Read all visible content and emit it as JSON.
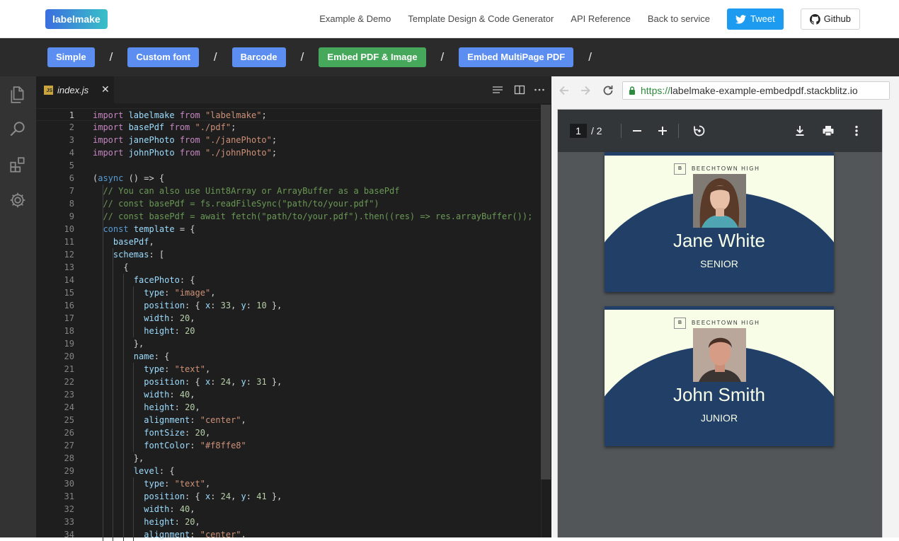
{
  "brand": "labelmake",
  "nav": {
    "links": [
      "Example & Demo",
      "Template Design & Code Generator",
      "API Reference",
      "Back to service"
    ],
    "tweet": "Tweet",
    "github": "Github"
  },
  "examples": {
    "items": [
      "Simple",
      "Custom font",
      "Barcode",
      "Embed PDF & Image",
      "Embed MultiPage PDF"
    ],
    "separator": "/",
    "active_index": 3
  },
  "editor": {
    "tab": "index.js",
    "tab_badge": "JS",
    "current_line": 1,
    "lines": [
      [
        [
          "k",
          "import "
        ],
        [
          "v",
          "labelmake "
        ],
        [
          "k",
          "from "
        ],
        [
          "s",
          "\"labelmake\""
        ],
        [
          "p",
          ";"
        ]
      ],
      [
        [
          "k",
          "import "
        ],
        [
          "v",
          "basePdf "
        ],
        [
          "k",
          "from "
        ],
        [
          "s",
          "\"./pdf\""
        ],
        [
          "p",
          ";"
        ]
      ],
      [
        [
          "k",
          "import "
        ],
        [
          "v",
          "janePhoto "
        ],
        [
          "k",
          "from "
        ],
        [
          "s",
          "\"./janePhoto\""
        ],
        [
          "p",
          ";"
        ]
      ],
      [
        [
          "k",
          "import "
        ],
        [
          "v",
          "johnPhoto "
        ],
        [
          "k",
          "from "
        ],
        [
          "s",
          "\"./johnPhoto\""
        ],
        [
          "p",
          ";"
        ]
      ],
      [],
      [
        [
          "p",
          "("
        ],
        [
          "kb",
          "async"
        ],
        [
          "p",
          " () => {"
        ]
      ],
      [
        [
          "p",
          "  "
        ],
        [
          "c",
          "// You can also use Uint8Array or ArrayBuffer as a basePdf"
        ]
      ],
      [
        [
          "p",
          "  "
        ],
        [
          "c",
          "// const basePdf = fs.readFileSync(\"path/to/your.pdf\")"
        ]
      ],
      [
        [
          "p",
          "  "
        ],
        [
          "c",
          "// const basePdf = await fetch(\"path/to/your.pdf\").then((res) => res.arrayBuffer());"
        ]
      ],
      [
        [
          "p",
          "  "
        ],
        [
          "kb",
          "const "
        ],
        [
          "v",
          "template"
        ],
        [
          "p",
          " = {"
        ]
      ],
      [
        [
          "p",
          "    "
        ],
        [
          "v",
          "basePdf"
        ],
        [
          "p",
          ","
        ]
      ],
      [
        [
          "p",
          "    "
        ],
        [
          "v",
          "schemas"
        ],
        [
          "p",
          ": ["
        ]
      ],
      [
        [
          "p",
          "      {"
        ]
      ],
      [
        [
          "p",
          "        "
        ],
        [
          "v",
          "facePhoto"
        ],
        [
          "p",
          ": {"
        ]
      ],
      [
        [
          "p",
          "          "
        ],
        [
          "v",
          "type"
        ],
        [
          "p",
          ": "
        ],
        [
          "s",
          "\"image\""
        ],
        [
          "p",
          ","
        ]
      ],
      [
        [
          "p",
          "          "
        ],
        [
          "v",
          "position"
        ],
        [
          "p",
          ": { "
        ],
        [
          "v",
          "x"
        ],
        [
          "p",
          ": "
        ],
        [
          "n",
          "33"
        ],
        [
          "p",
          ", "
        ],
        [
          "v",
          "y"
        ],
        [
          "p",
          ": "
        ],
        [
          "n",
          "10"
        ],
        [
          "p",
          " },"
        ]
      ],
      [
        [
          "p",
          "          "
        ],
        [
          "v",
          "width"
        ],
        [
          "p",
          ": "
        ],
        [
          "n",
          "20"
        ],
        [
          "p",
          ","
        ]
      ],
      [
        [
          "p",
          "          "
        ],
        [
          "v",
          "height"
        ],
        [
          "p",
          ": "
        ],
        [
          "n",
          "20"
        ]
      ],
      [
        [
          "p",
          "        },"
        ]
      ],
      [
        [
          "p",
          "        "
        ],
        [
          "v",
          "name"
        ],
        [
          "p",
          ": {"
        ]
      ],
      [
        [
          "p",
          "          "
        ],
        [
          "v",
          "type"
        ],
        [
          "p",
          ": "
        ],
        [
          "s",
          "\"text\""
        ],
        [
          "p",
          ","
        ]
      ],
      [
        [
          "p",
          "          "
        ],
        [
          "v",
          "position"
        ],
        [
          "p",
          ": { "
        ],
        [
          "v",
          "x"
        ],
        [
          "p",
          ": "
        ],
        [
          "n",
          "24"
        ],
        [
          "p",
          ", "
        ],
        [
          "v",
          "y"
        ],
        [
          "p",
          ": "
        ],
        [
          "n",
          "31"
        ],
        [
          "p",
          " },"
        ]
      ],
      [
        [
          "p",
          "          "
        ],
        [
          "v",
          "width"
        ],
        [
          "p",
          ": "
        ],
        [
          "n",
          "40"
        ],
        [
          "p",
          ","
        ]
      ],
      [
        [
          "p",
          "          "
        ],
        [
          "v",
          "height"
        ],
        [
          "p",
          ": "
        ],
        [
          "n",
          "20"
        ],
        [
          "p",
          ","
        ]
      ],
      [
        [
          "p",
          "          "
        ],
        [
          "v",
          "alignment"
        ],
        [
          "p",
          ": "
        ],
        [
          "s",
          "\"center\""
        ],
        [
          "p",
          ","
        ]
      ],
      [
        [
          "p",
          "          "
        ],
        [
          "v",
          "fontSize"
        ],
        [
          "p",
          ": "
        ],
        [
          "n",
          "20"
        ],
        [
          "p",
          ","
        ]
      ],
      [
        [
          "p",
          "          "
        ],
        [
          "v",
          "fontColor"
        ],
        [
          "p",
          ": "
        ],
        [
          "s",
          "\"#f8ffe8\""
        ]
      ],
      [
        [
          "p",
          "        },"
        ]
      ],
      [
        [
          "p",
          "        "
        ],
        [
          "v",
          "level"
        ],
        [
          "p",
          ": {"
        ]
      ],
      [
        [
          "p",
          "          "
        ],
        [
          "v",
          "type"
        ],
        [
          "p",
          ": "
        ],
        [
          "s",
          "\"text\""
        ],
        [
          "p",
          ","
        ]
      ],
      [
        [
          "p",
          "          "
        ],
        [
          "v",
          "position"
        ],
        [
          "p",
          ": { "
        ],
        [
          "v",
          "x"
        ],
        [
          "p",
          ": "
        ],
        [
          "n",
          "24"
        ],
        [
          "p",
          ", "
        ],
        [
          "v",
          "y"
        ],
        [
          "p",
          ": "
        ],
        [
          "n",
          "41"
        ],
        [
          "p",
          " },"
        ]
      ],
      [
        [
          "p",
          "          "
        ],
        [
          "v",
          "width"
        ],
        [
          "p",
          ": "
        ],
        [
          "n",
          "40"
        ],
        [
          "p",
          ","
        ]
      ],
      [
        [
          "p",
          "          "
        ],
        [
          "v",
          "height"
        ],
        [
          "p",
          ": "
        ],
        [
          "n",
          "20"
        ],
        [
          "p",
          ","
        ]
      ],
      [
        [
          "p",
          "          "
        ],
        [
          "v",
          "alignment"
        ],
        [
          "p",
          ": "
        ],
        [
          "s",
          "\"center\""
        ],
        [
          "p",
          ","
        ]
      ]
    ]
  },
  "browser": {
    "url_scheme": "https://",
    "url_rest": "labelmake-example-embedpdf.stackblitz.io"
  },
  "pdf": {
    "current_page": "1",
    "total": "/  2",
    "badges": [
      {
        "school": "BEECHTOWN HIGH",
        "mark": "B",
        "name": "Jane White",
        "level": "SENIOR"
      },
      {
        "school": "BEECHTOWN HIGH",
        "mark": "B",
        "name": "John Smith",
        "level": "JUNIOR"
      }
    ]
  },
  "colors": {
    "brand_from": "#3b6ee0",
    "brand_to": "#38c0c7",
    "example_button": "#5b8ef0",
    "example_active": "#46a85a",
    "tweet": "#1d9bf0",
    "badge_navy": "#223f68",
    "badge_bg": "#f7fde7"
  }
}
